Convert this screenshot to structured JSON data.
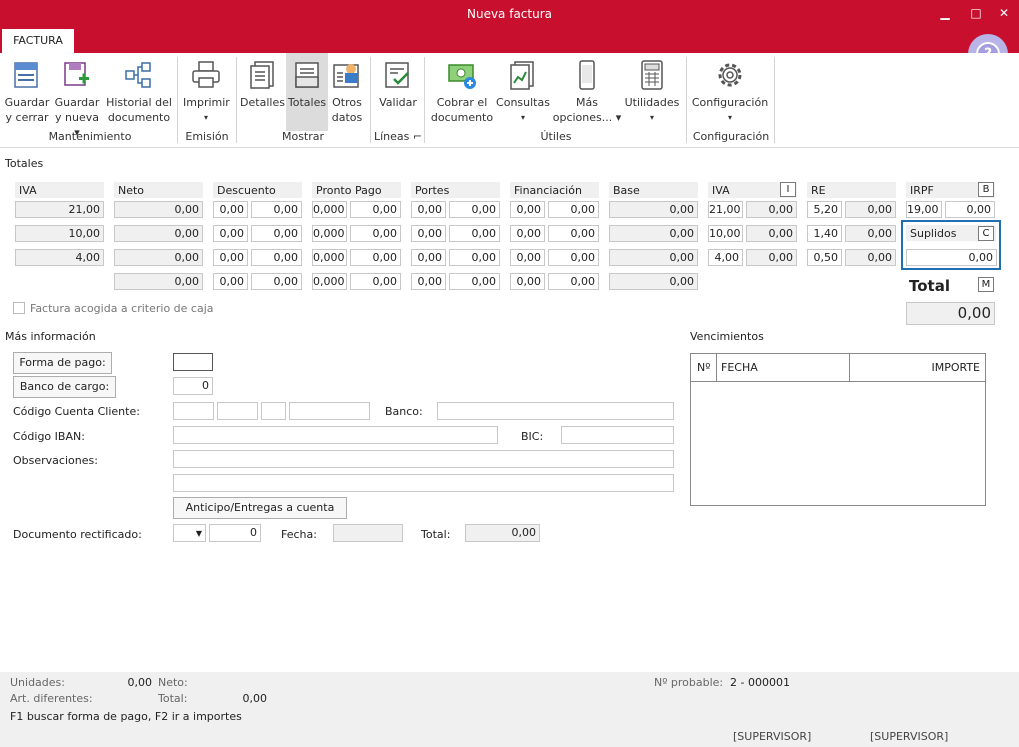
{
  "window": {
    "title": "Nueva factura",
    "minimize": "▁",
    "maximize": "□",
    "close": "✕"
  },
  "tab": {
    "label": "FACTURA"
  },
  "help": {
    "label": "?"
  },
  "ribbon": {
    "guardar_cerrar": [
      "Guardar",
      "y cerrar"
    ],
    "guardar_nueva": [
      "Guardar",
      "y nueva ▾"
    ],
    "historial": [
      "Historial del",
      "documento"
    ],
    "imprimir": [
      "Imprimir",
      "▾"
    ],
    "detalles": [
      "Detalles"
    ],
    "totales": [
      "Totales"
    ],
    "otros": [
      "Otros",
      "datos"
    ],
    "validar": [
      "Validar"
    ],
    "cobrar": [
      "Cobrar el",
      "documento"
    ],
    "consultas": [
      "Consultas",
      "▾"
    ],
    "mas": [
      "Más",
      "opciones... ▾"
    ],
    "utilidades": [
      "Utilidades",
      "▾"
    ],
    "configuracion": [
      "Configuración",
      "▾"
    ],
    "groups": {
      "mantenimiento": "Mantenimiento",
      "emision": "Emisión",
      "mostrar": "Mostrar",
      "lineas": "Líneas ⌐",
      "utiles": "Útiles",
      "configuracion": "Configuración"
    }
  },
  "totales": {
    "title": "Totales",
    "headers": {
      "iva": "IVA",
      "neto": "Neto",
      "descuento": "Descuento",
      "pronto": "Pronto Pago",
      "portes": "Portes",
      "financiacion": "Financiación",
      "base": "Base",
      "iva2": "IVA",
      "re": "RE",
      "irpf": "IRPF"
    },
    "badges": {
      "iva": "I",
      "irpf": "B",
      "suplidos": "C",
      "total": "M"
    },
    "rows": [
      {
        "iva": "21,00",
        "neto": "0,00",
        "d1": "0,00",
        "d2": "0,00",
        "p1": "0,000",
        "p2": "0,00",
        "po1": "0,00",
        "po2": "0,00",
        "f1": "0,00",
        "f2": "0,00",
        "base": "0,00",
        "iv": "21,00",
        "ivv": "0,00",
        "re": "5,20",
        "rev": "0,00"
      },
      {
        "iva": "10,00",
        "neto": "0,00",
        "d1": "0,00",
        "d2": "0,00",
        "p1": "0,000",
        "p2": "0,00",
        "po1": "0,00",
        "po2": "0,00",
        "f1": "0,00",
        "f2": "0,00",
        "base": "0,00",
        "iv": "10,00",
        "ivv": "0,00",
        "re": "1,40",
        "rev": "0,00"
      },
      {
        "iva": "4,00",
        "neto": "0,00",
        "d1": "0,00",
        "d2": "0,00",
        "p1": "0,000",
        "p2": "0,00",
        "po1": "0,00",
        "po2": "0,00",
        "f1": "0,00",
        "f2": "0,00",
        "base": "0,00",
        "iv": "4,00",
        "ivv": "0,00",
        "re": "0,50",
        "rev": "0,00"
      },
      {
        "iva": "",
        "neto": "0,00",
        "d1": "0,00",
        "d2": "0,00",
        "p1": "0,000",
        "p2": "0,00",
        "po1": "0,00",
        "po2": "0,00",
        "f1": "0,00",
        "f2": "0,00",
        "base": "0,00",
        "iv": "",
        "ivv": "",
        "re": "",
        "rev": ""
      }
    ],
    "irpf": {
      "pct": "19,00",
      "value": "0,00"
    },
    "suplidos": {
      "label": "Suplidos",
      "value": "0,00"
    },
    "total": {
      "label": "Total",
      "value": "0,00"
    },
    "criterio_caja": "Factura acogida a criterio de caja"
  },
  "mas_info": {
    "title": "Más información",
    "forma_pago": "Forma de pago:",
    "banco_cargo": "Banco de cargo:",
    "banco_cargo_value": "0",
    "codigo_cuenta": "Código Cuenta Cliente:",
    "banco": "Banco:",
    "iban": "Código IBAN:",
    "bic": "BIC:",
    "observaciones": "Observaciones:",
    "anticipo": "Anticipo/Entregas a cuenta",
    "doc_rect": "Documento rectificado:",
    "doc_rect_value": "0",
    "fecha": "Fecha:",
    "total": "Total:",
    "total_value": "0,00"
  },
  "vencimientos": {
    "title": "Vencimientos",
    "cols": {
      "n": "Nº",
      "fecha": "FECHA",
      "importe": "IMPORTE"
    }
  },
  "status": {
    "unidades": "Unidades:",
    "unidades_v": "0,00",
    "neto": "Neto:",
    "art": "Art. diferentes:",
    "total": "Total:",
    "total_v": "0,00",
    "hint": "F1 buscar forma de pago, F2 ir a importes",
    "nprob": "Nº probable:",
    "nprob_v": "2 - 000001",
    "sup1": "[SUPERVISOR]",
    "sup2": "[SUPERVISOR]"
  }
}
